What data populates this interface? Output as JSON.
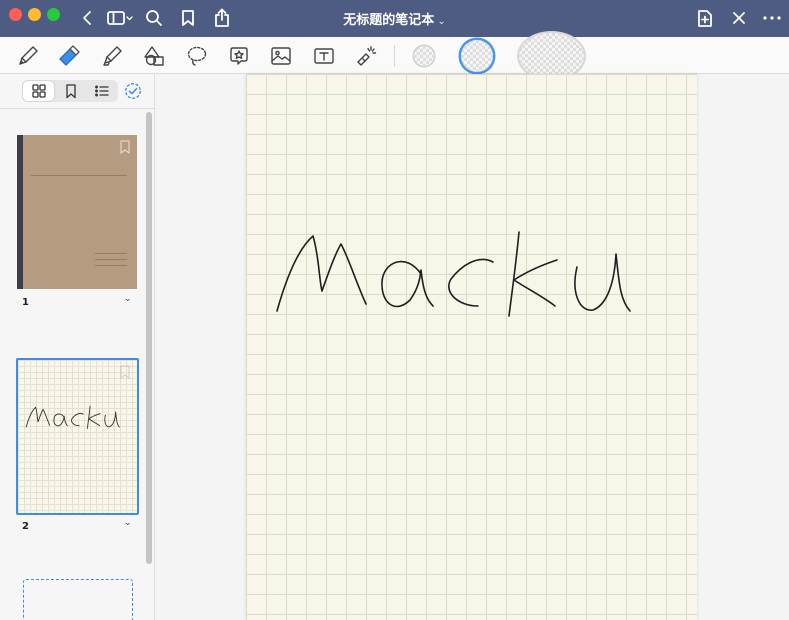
{
  "titlebar": {
    "title": "无标题的笔记本",
    "title_caret": "⌄",
    "bg_color": "#4e5b82"
  },
  "toolbar": {
    "tools": [
      {
        "name": "pen-tool",
        "icon": "pen-icon"
      },
      {
        "name": "eraser-tool",
        "icon": "eraser-icon",
        "selected": true
      },
      {
        "name": "highlighter-tool",
        "icon": "highlighter-icon"
      },
      {
        "name": "shapes-tool",
        "icon": "shapes-icon"
      },
      {
        "name": "lasso-tool",
        "icon": "lasso-icon"
      },
      {
        "name": "sticker-tool",
        "icon": "sticker-icon"
      },
      {
        "name": "image-tool",
        "icon": "image-icon"
      },
      {
        "name": "text-tool",
        "icon": "text-box-icon"
      },
      {
        "name": "laser-tool",
        "icon": "laser-pointer-icon"
      }
    ],
    "eraser_accent": "#3b8de8"
  },
  "sidebar": {
    "tabs": [
      {
        "name": "thumbnails-tab",
        "icon": "grid-icon",
        "active": true
      },
      {
        "name": "bookmarks-tab",
        "icon": "bookmark-icon"
      },
      {
        "name": "outline-tab",
        "icon": "list-icon"
      }
    ],
    "pages": [
      {
        "number": "1",
        "caret": "⌄",
        "kind": "cover"
      },
      {
        "number": "2",
        "caret": "⌄",
        "kind": "grid",
        "selected": true,
        "ink_text": "macku"
      }
    ],
    "accent": "#3b8de8"
  },
  "canvas": {
    "handwriting": "macku",
    "paper_color": "#f8f6e8",
    "grid_color": "#dcdbc9"
  }
}
